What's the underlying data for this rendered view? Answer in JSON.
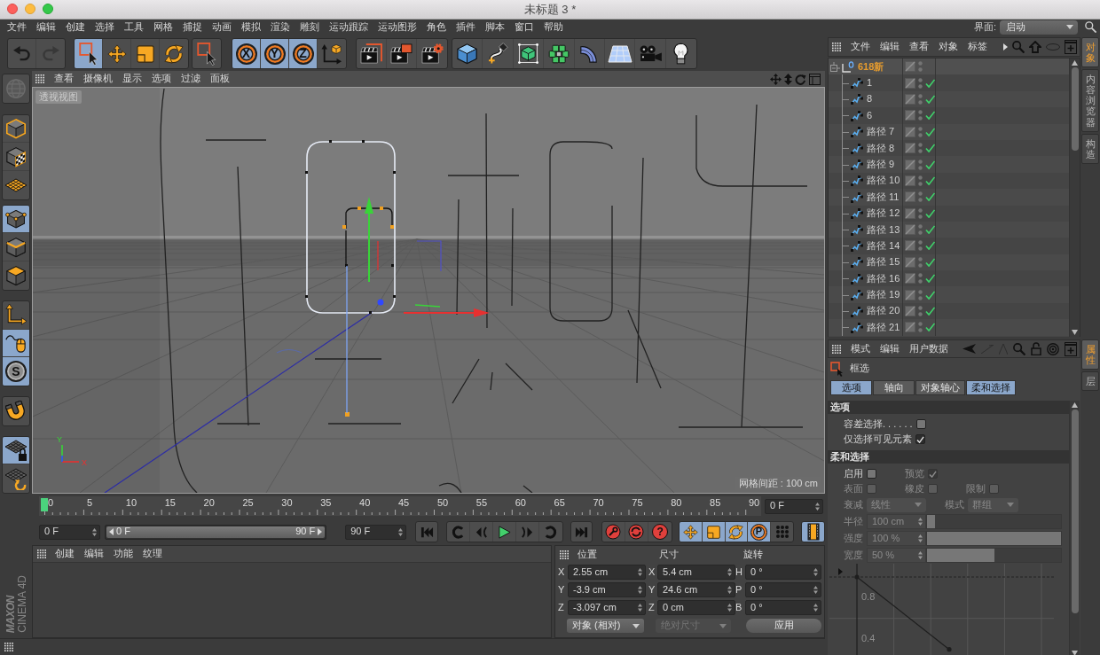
{
  "window": {
    "title": "未标题 3 *"
  },
  "menu_bar": {
    "items": [
      "文件",
      "编辑",
      "创建",
      "选择",
      "工具",
      "网格",
      "捕捉",
      "动画",
      "模拟",
      "渲染",
      "雕刻",
      "运动跟踪",
      "运动图形",
      "角色",
      "插件",
      "脚本",
      "窗口",
      "帮助"
    ],
    "layout_label": "界面:",
    "layout_value": "启动"
  },
  "toolbar": {
    "groups": [
      [
        {
          "selected": false,
          "disabled": false
        },
        {
          "selected": false,
          "disabled": true
        }
      ],
      [
        {
          "selected": true,
          "disabled": false
        },
        {
          "selected": false,
          "disabled": false
        },
        {
          "selected": false,
          "disabled": false
        },
        {
          "selected": false,
          "disabled": false
        }
      ],
      [
        {
          "selected": false,
          "disabled": false
        }
      ],
      [
        {
          "label": "X",
          "selected": true,
          "disabled": false
        },
        {
          "label": "Y",
          "selected": true,
          "disabled": false
        },
        {
          "label": "Z",
          "selected": true,
          "disabled": false
        },
        {
          "selected": false,
          "disabled": false
        }
      ],
      [
        {
          "selected": false,
          "disabled": false
        },
        {
          "selected": false,
          "disabled": false
        },
        {
          "selected": false,
          "disabled": false
        }
      ],
      [
        {
          "selected": false,
          "disabled": false
        },
        {
          "selected": false,
          "disabled": false
        },
        {
          "selected": false,
          "disabled": false
        },
        {
          "selected": false,
          "disabled": false
        },
        {
          "selected": false,
          "disabled": false
        },
        {
          "selected": false,
          "disabled": false
        },
        {
          "selected": false,
          "disabled": false
        },
        {
          "selected": false,
          "disabled": false
        }
      ]
    ]
  },
  "left_toolbar": {
    "groups": [
      [
        {
          "selected": false,
          "disabled": true
        }
      ],
      [
        {
          "selected": false,
          "disabled": false
        },
        {
          "selected": false,
          "disabled": false
        },
        {
          "selected": false,
          "disabled": false
        }
      ],
      [
        {
          "selected": true,
          "disabled": false
        },
        {
          "selected": false,
          "disabled": false
        },
        {
          "selected": false,
          "disabled": false
        }
      ],
      [
        {
          "selected": false,
          "disabled": false
        },
        {
          "selected": true,
          "disabled": false
        },
        {
          "label": "S",
          "selected": true,
          "disabled": false
        }
      ],
      [
        {
          "selected": false,
          "disabled": false
        }
      ],
      [
        {
          "selected": true,
          "disabled": false
        },
        {
          "selected": false,
          "disabled": false
        }
      ]
    ]
  },
  "viewport": {
    "menu": [
      "查看",
      "摄像机",
      "显示",
      "选项",
      "过滤",
      "面板"
    ],
    "view_name": "透视视图",
    "grid_spacing": "网格间距 : 100 cm",
    "axis_labels": [
      "Y",
      "X"
    ]
  },
  "timeline": {
    "frames": [
      "0",
      "5",
      "10",
      "15",
      "20",
      "25",
      "30",
      "35",
      "40",
      "45",
      "50",
      "55",
      "60",
      "65",
      "70",
      "75",
      "80",
      "85",
      "90"
    ],
    "playhead": {
      "level": 0
    },
    "current_frame": "0 F"
  },
  "transport": {
    "start": "0 F",
    "range": {
      "start": "0 F",
      "end": "90 F",
      "level": 1
    },
    "end": "90 F",
    "groups": [
      [
        {
          "selected": false
        }
      ],
      [
        {
          "selected": false
        },
        {
          "selected": false
        },
        {
          "selected": false
        },
        {
          "selected": false
        },
        {
          "selected": false
        }
      ],
      [
        {
          "selected": false
        }
      ],
      [
        {
          "selected": false
        },
        {
          "selected": false
        },
        {
          "label": "?",
          "selected": false
        }
      ],
      [
        {
          "selected": true
        },
        {
          "selected": true
        },
        {
          "selected": true
        },
        {
          "label": "P",
          "selected": true
        },
        {
          "selected": false
        }
      ],
      [
        {
          "selected": true
        }
      ]
    ]
  },
  "material_manager": {
    "menu": [
      "创建",
      "编辑",
      "功能",
      "纹理"
    ]
  },
  "logo": {
    "brand": "MAXON",
    "product": "CINEMA 4D"
  },
  "coordinates": {
    "headings": [
      "位置",
      "尺寸",
      "旋转"
    ],
    "columns": [
      [
        {
          "axis": "X",
          "value": "2.55 cm"
        },
        {
          "axis": "Y",
          "value": "-3.9 cm"
        },
        {
          "axis": "Z",
          "value": "-3.097 cm"
        }
      ],
      [
        {
          "axis": "X",
          "value": "5.4 cm"
        },
        {
          "axis": "Y",
          "value": "24.6 cm"
        },
        {
          "axis": "Z",
          "value": "0 cm"
        }
      ],
      [
        {
          "axis": "H",
          "value": "0 °"
        },
        {
          "axis": "P",
          "value": "0 °"
        },
        {
          "axis": "B",
          "value": "0 °"
        }
      ]
    ],
    "mode": {
      "value": "对象 (相对)",
      "disabled": false
    },
    "size_mode": {
      "value": "绝对尺寸",
      "disabled": true
    },
    "apply": "应用"
  },
  "objects": {
    "menu": [
      "文件",
      "编辑",
      "查看",
      "对象",
      "标签"
    ],
    "tree": [
      {
        "name": "618新",
        "selected": true,
        "expanded": true,
        "children": [
          {
            "name": "1",
            "selected": false,
            "checked": true
          },
          {
            "name": "8",
            "selected": false,
            "checked": true
          },
          {
            "name": "6",
            "selected": false,
            "checked": true
          },
          {
            "name": "路径 7",
            "selected": false,
            "checked": true
          },
          {
            "name": "路径 8",
            "selected": false,
            "checked": true
          },
          {
            "name": "路径 9",
            "selected": false,
            "checked": true
          },
          {
            "name": "路径 10",
            "selected": false,
            "checked": true
          },
          {
            "name": "路径 11",
            "selected": false,
            "checked": true
          },
          {
            "name": "路径 12",
            "selected": false,
            "checked": true
          },
          {
            "name": "路径 13",
            "selected": false,
            "checked": true
          },
          {
            "name": "路径 14",
            "selected": false,
            "checked": true
          },
          {
            "name": "路径 15",
            "selected": false,
            "checked": true
          },
          {
            "name": "路径 16",
            "selected": false,
            "checked": true
          },
          {
            "name": "路径 19",
            "selected": false,
            "checked": true
          },
          {
            "name": "路径 20",
            "selected": false,
            "checked": true
          },
          {
            "name": "路径 21",
            "selected": false,
            "checked": true
          }
        ]
      }
    ]
  },
  "attributes": {
    "menu": [
      "模式",
      "编辑",
      "用户数据"
    ],
    "mode_title": "框选",
    "tabs": [
      {
        "label": "选项",
        "selected": true
      },
      {
        "label": "轴向",
        "selected": false
      },
      {
        "label": "对象轴心",
        "selected": false
      },
      {
        "label": "柔和选择",
        "selected": true
      }
    ],
    "sections": [
      {
        "title": "选项",
        "rows": [
          {
            "kind": "checks",
            "items": [
              {
                "label": "容差选择. . . . . .",
                "checked": false,
                "disabled": false
              }
            ]
          },
          {
            "kind": "checks",
            "items": [
              {
                "label": "仅选择可见元素",
                "checked": true,
                "disabled": false
              }
            ]
          }
        ]
      },
      {
        "title": "柔和选择",
        "rows": [
          {
            "kind": "checks",
            "items": [
              {
                "label": "启用",
                "checked": false,
                "disabled": false
              },
              {
                "label": "预览",
                "checked": true,
                "disabled": true
              }
            ]
          },
          {
            "kind": "checks",
            "items": [
              {
                "label": "表面",
                "checked": false,
                "disabled": true
              },
              {
                "label": "橡皮",
                "checked": false,
                "disabled": true
              },
              {
                "label": "限制",
                "checked": false,
                "disabled": true
              }
            ]
          },
          {
            "kind": "dropdowns",
            "items": [
              {
                "label": "衰减",
                "value": "线性",
                "disabled": true
              },
              {
                "label": "模式",
                "value": "群组",
                "disabled": true
              }
            ]
          },
          {
            "kind": "slider",
            "label": "半径",
            "value": "100 cm",
            "level": 0.06,
            "disabled": true
          },
          {
            "kind": "slider",
            "label": "强度",
            "value": "100 %",
            "level": 1,
            "disabled": true
          },
          {
            "kind": "slider",
            "label": "宽度",
            "value": "50 %",
            "level": 0.5,
            "disabled": true
          }
        ]
      }
    ],
    "falloff_graph": {
      "labels": [
        "0.8",
        "0.4"
      ]
    }
  },
  "side_tabs": {
    "top": [
      {
        "label": "对象",
        "selected": true
      },
      {
        "label": "内容浏览器",
        "selected": false
      },
      {
        "label": "构造",
        "selected": false
      }
    ],
    "bottom": [
      {
        "label": "属性",
        "selected": true
      },
      {
        "label": "层",
        "selected": false
      }
    ]
  }
}
